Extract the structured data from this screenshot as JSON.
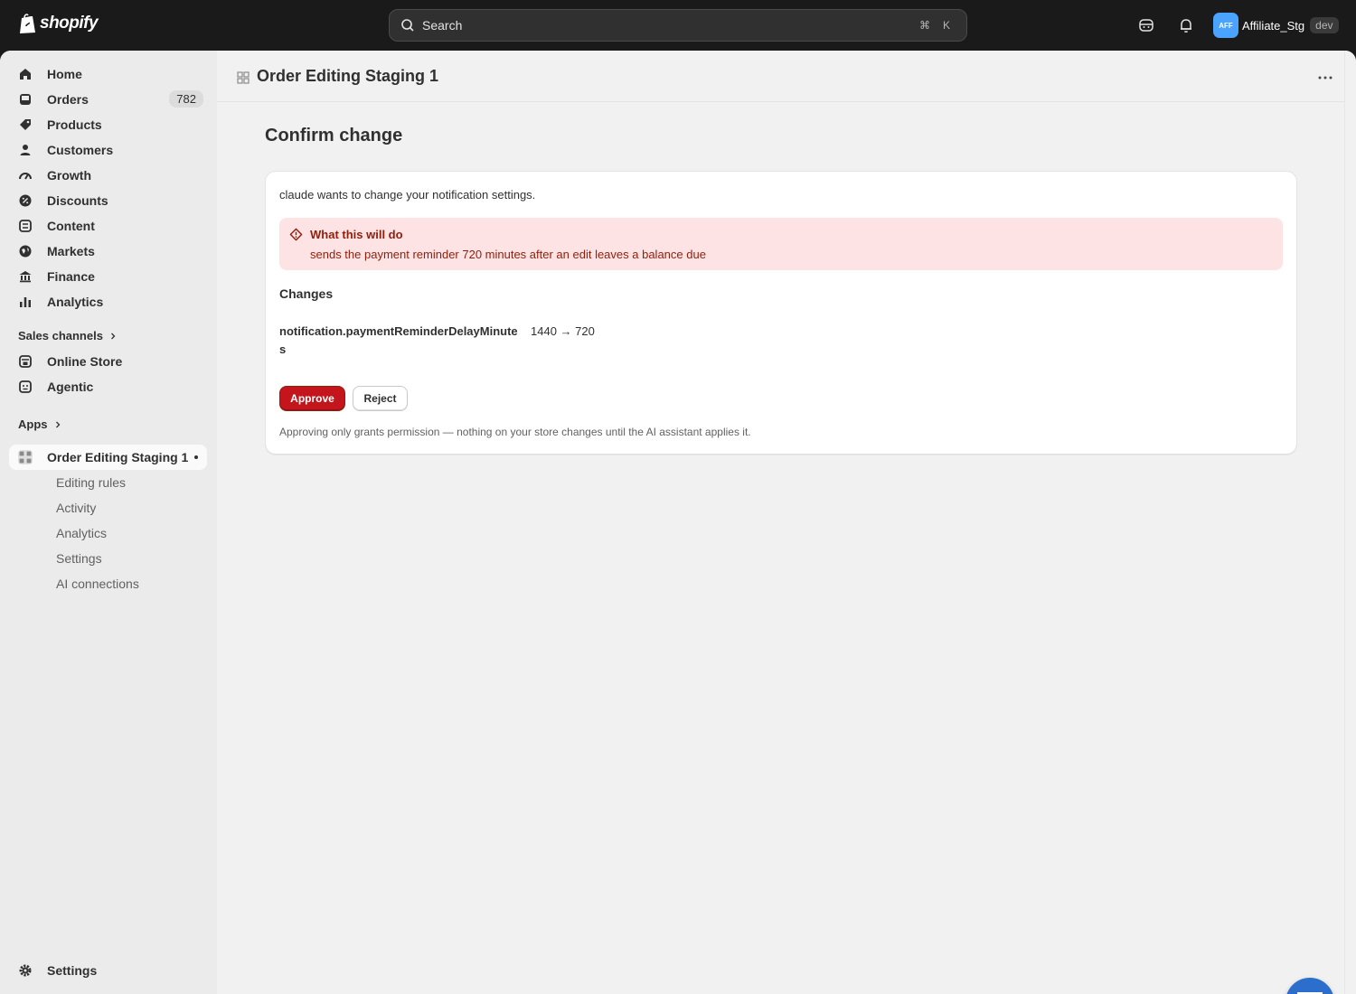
{
  "brand": {
    "name": "shopify"
  },
  "search": {
    "placeholder": "Search",
    "shortcut_mod": "⌘",
    "shortcut_key": "K"
  },
  "account": {
    "initials": "AFF",
    "name": "Affiliate_Stg",
    "badge": "dev",
    "avatar_color": "#4aa3ff"
  },
  "sidebar": {
    "items": [
      {
        "label": "Home",
        "icon": "home-icon"
      },
      {
        "label": "Orders",
        "icon": "inbox-icon",
        "count": "782"
      },
      {
        "label": "Products",
        "icon": "tag-icon"
      },
      {
        "label": "Customers",
        "icon": "person-icon"
      },
      {
        "label": "Growth",
        "icon": "gauge-icon"
      },
      {
        "label": "Discounts",
        "icon": "discount-icon"
      },
      {
        "label": "Content",
        "icon": "content-icon"
      },
      {
        "label": "Markets",
        "icon": "globe-icon"
      },
      {
        "label": "Finance",
        "icon": "bank-icon"
      },
      {
        "label": "Analytics",
        "icon": "bar-chart-icon"
      }
    ],
    "sales_channels_label": "Sales channels",
    "channels": [
      {
        "label": "Online Store",
        "icon": "store-icon"
      },
      {
        "label": "Agentic",
        "icon": "agent-icon"
      }
    ],
    "apps_label": "Apps",
    "app": {
      "label": "Order Editing Staging 1",
      "subitems": [
        "Editing rules",
        "Activity",
        "Analytics",
        "Settings",
        "AI connections"
      ]
    },
    "settings_label": "Settings"
  },
  "titlebar": {
    "title": "Order Editing Staging 1"
  },
  "page": {
    "heading": "Confirm change",
    "intro": "claude wants to change your notification settings.",
    "banner": {
      "title": "What this will do",
      "text": "sends the payment reminder 720 minutes after an edit leaves a balance due"
    },
    "changes_heading": "Changes",
    "change": {
      "field": "notification.paymentReminderDelayMinutes",
      "value": "1440 → 720"
    },
    "approve_label": "Approve",
    "reject_label": "Reject",
    "footnote": "Approving only grants permission — nothing on your store changes until the AI assistant applies it."
  },
  "colors": {
    "critical": "#c4151c",
    "banner_bg": "#fee3e5",
    "chat": "#2c6ecb"
  }
}
